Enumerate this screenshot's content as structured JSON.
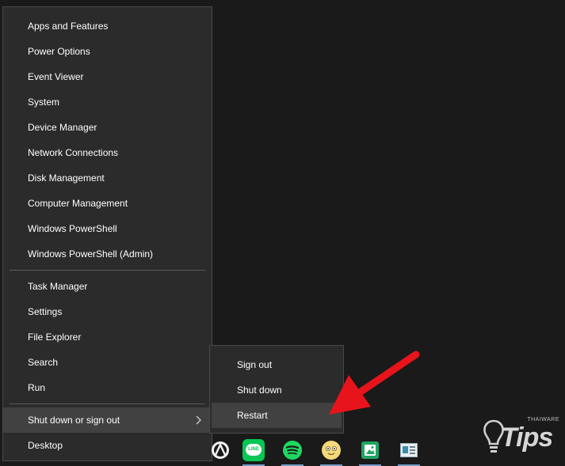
{
  "menu": {
    "items": [
      {
        "label": "Apps and Features"
      },
      {
        "label": "Power Options"
      },
      {
        "label": "Event Viewer"
      },
      {
        "label": "System"
      },
      {
        "label": "Device Manager"
      },
      {
        "label": "Network Connections"
      },
      {
        "label": "Disk Management"
      },
      {
        "label": "Computer Management"
      },
      {
        "label": "Windows PowerShell"
      },
      {
        "label": "Windows PowerShell (Admin)"
      },
      {
        "label": "Task Manager"
      },
      {
        "label": "Settings"
      },
      {
        "label": "File Explorer"
      },
      {
        "label": "Search"
      },
      {
        "label": "Run"
      },
      {
        "label": "Shut down or sign out"
      },
      {
        "label": "Desktop"
      }
    ]
  },
  "submenu": {
    "items": [
      {
        "label": "Sign out"
      },
      {
        "label": "Shut down"
      },
      {
        "label": "Restart"
      }
    ]
  },
  "taskbar": {
    "icons": [
      "app-icon",
      "line-icon",
      "spotify-icon",
      "emoji-app-icon",
      "photo-app-icon",
      "news-app-icon"
    ],
    "line_label": "LINE"
  },
  "watermark": {
    "main": "Tips",
    "small": "THAIWARE"
  },
  "colors": {
    "menu_bg": "#2b2b2b",
    "highlight": "#414141",
    "arrow": "#e8141b",
    "line_green": "#06c755",
    "spotify_green": "#1ed760"
  }
}
